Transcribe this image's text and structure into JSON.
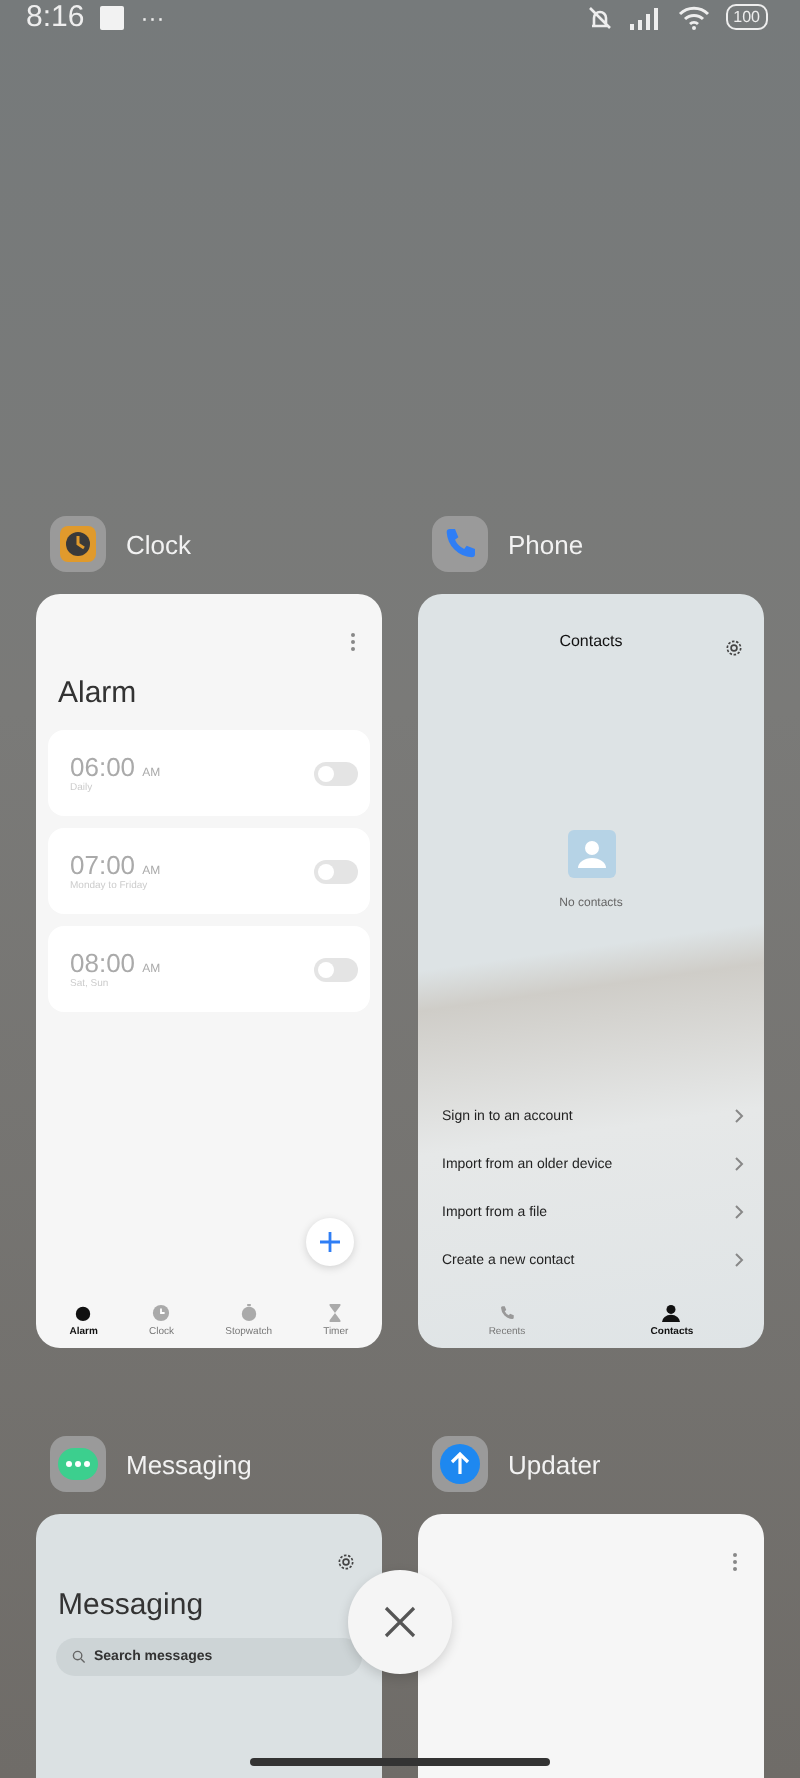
{
  "status_bar": {
    "time": "8:16",
    "more": "···",
    "battery": "100"
  },
  "apps": [
    {
      "kind": "clock",
      "name": "Clock",
      "title": "Alarm",
      "alarms": [
        {
          "time": "06:00",
          "period": "AM",
          "repeat": "Daily",
          "on": false
        },
        {
          "time": "07:00",
          "period": "AM",
          "repeat": "Monday to Friday",
          "on": false
        },
        {
          "time": "08:00",
          "period": "AM",
          "repeat": "Sat, Sun",
          "on": false
        }
      ],
      "tabs": [
        {
          "label": "Alarm",
          "selected": true
        },
        {
          "label": "Clock",
          "selected": false
        },
        {
          "label": "Stopwatch",
          "selected": false
        },
        {
          "label": "Timer",
          "selected": false
        }
      ]
    },
    {
      "kind": "phone",
      "name": "Phone",
      "title": "Contacts",
      "empty": "No contacts",
      "actions": [
        "Sign in to an account",
        "Import from an older device",
        "Import from a file",
        "Create a new contact"
      ],
      "tabs": [
        {
          "label": "Recents",
          "selected": false
        },
        {
          "label": "Contacts",
          "selected": true
        }
      ]
    },
    {
      "kind": "messaging",
      "name": "Messaging",
      "title": "Messaging",
      "search": {
        "placeholder": "Search messages"
      }
    },
    {
      "kind": "updater",
      "name": "Updater"
    }
  ]
}
